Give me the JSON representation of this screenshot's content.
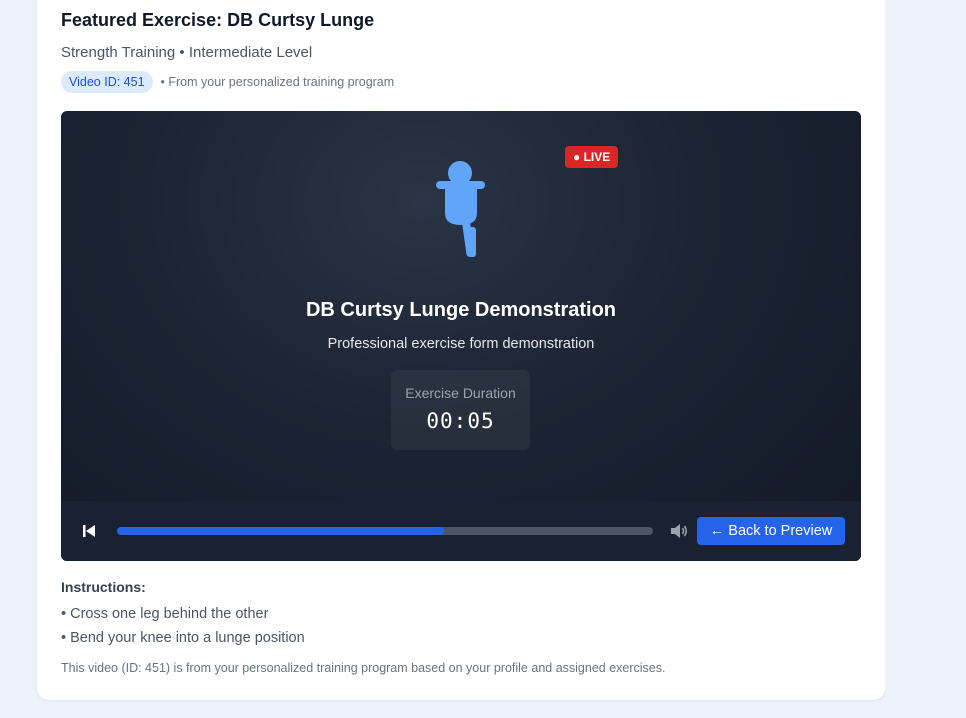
{
  "exercise": {
    "title": "Featured Exercise: DB Curtsy Lunge",
    "subtitle": "Strength Training • Intermediate Level",
    "video_id_badge": "Video ID: 451",
    "source_note": "• From your personalized training program"
  },
  "video": {
    "live_badge": "● LIVE",
    "title": "DB Curtsy Lunge Demonstration",
    "subtitle": "Professional exercise form demonstration",
    "duration_label": "Exercise Duration",
    "duration_time": "00:05",
    "progress": 0.61,
    "figure_icon": "exercise-figure-icon",
    "accent_color": "#2563eb",
    "live_color": "#dc2626"
  },
  "controls": {
    "prev_icon": "skip-back-icon",
    "volume_icon": "volume-icon",
    "back_button_label": "← Back to Preview"
  },
  "instructions": {
    "heading": "Instructions:",
    "items": [
      "• Cross one leg behind the other",
      "• Bend your knee into a lunge position"
    ],
    "footnote": "This video (ID: 451) is from your personalized training program based on your profile and assigned exercises."
  }
}
